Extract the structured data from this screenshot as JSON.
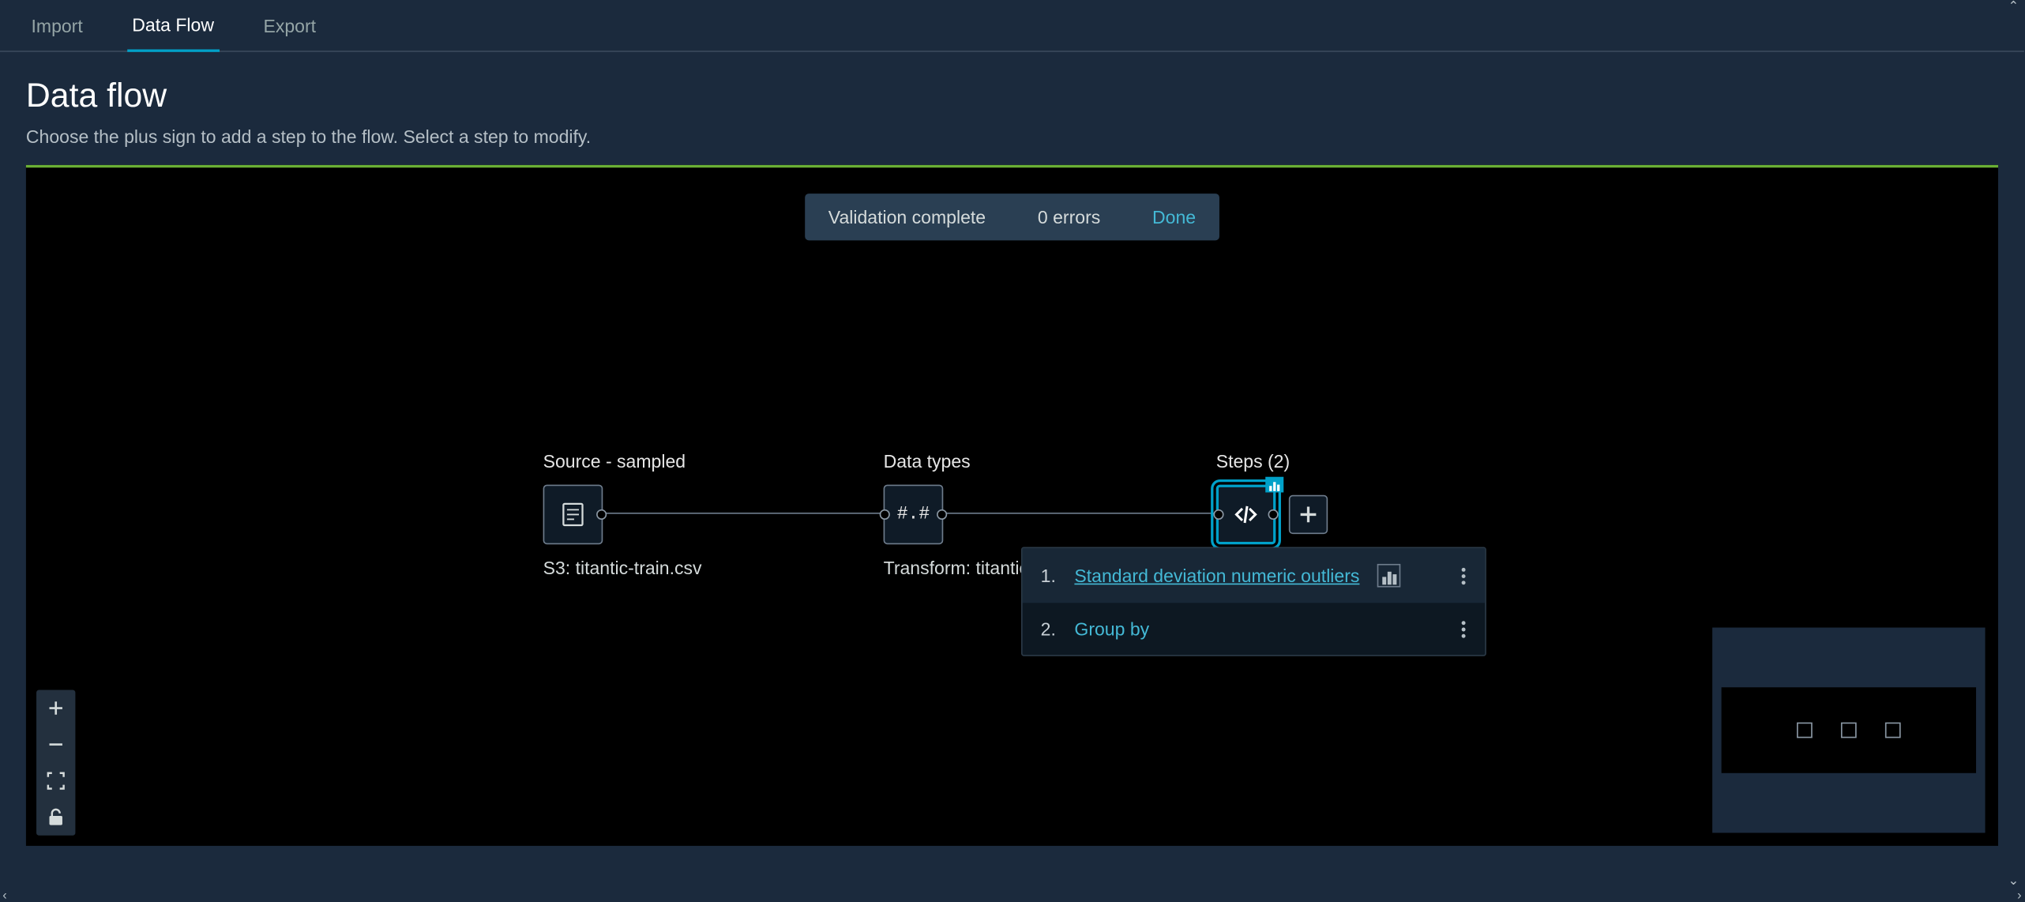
{
  "tabs": {
    "import": "Import",
    "dataflow": "Data Flow",
    "export": "Export"
  },
  "header": {
    "title": "Data flow",
    "subtitle": "Choose the plus sign to add a step to the flow. Select a step to modify."
  },
  "toast": {
    "message": "Validation complete",
    "errors": "0 errors",
    "done": "Done"
  },
  "nodes": {
    "source": {
      "label": "Source - sampled",
      "caption": "S3: titantic-train.csv"
    },
    "types": {
      "label": "Data types",
      "symbol": "#.#",
      "caption": "Transform: titantic"
    },
    "steps": {
      "label": "Steps (2)"
    }
  },
  "steps_popup": [
    {
      "num": "1.",
      "label": "Standard deviation numeric outliers",
      "has_chart": true,
      "underlined": true
    },
    {
      "num": "2.",
      "label": "Group by",
      "has_chart": false,
      "underlined": false
    }
  ]
}
